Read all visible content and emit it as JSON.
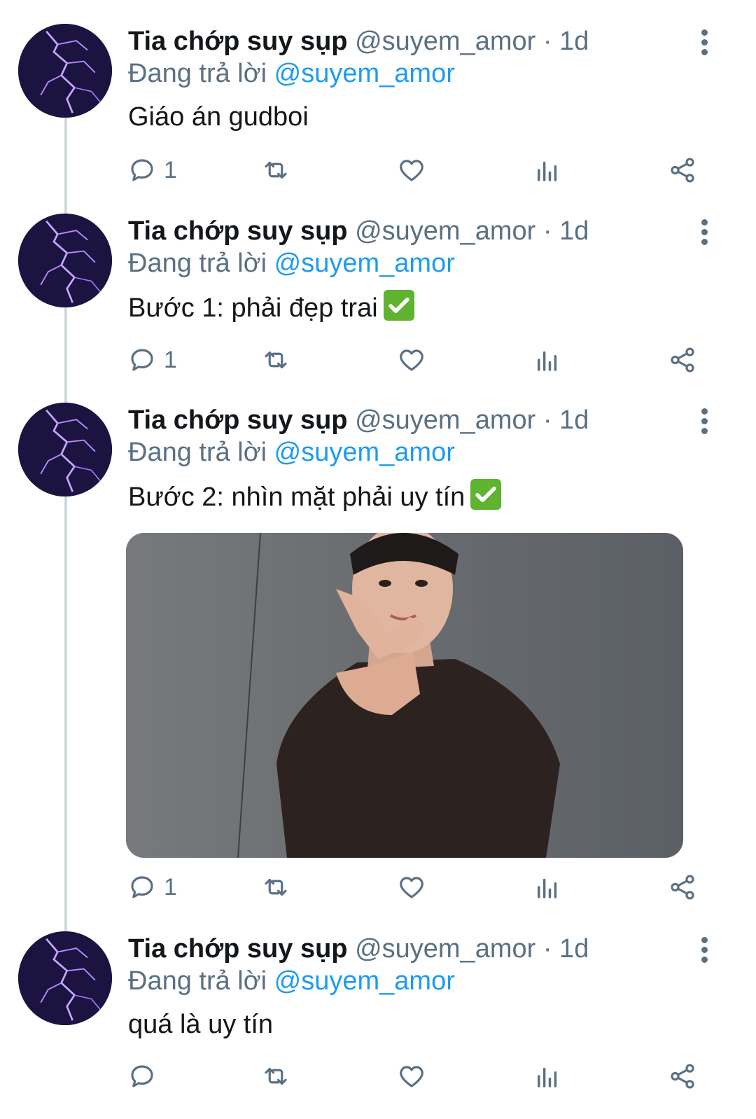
{
  "reply_prefix": "Đang trả lời",
  "tweets": [
    {
      "name": "Tia chớp suy sụp",
      "handle": "@suyem_amor",
      "separator": "·",
      "time": "1d",
      "reply_to": "@suyem_amor",
      "text": "Giáo án gudboi",
      "reply_count": "1",
      "has_check": false,
      "has_photo": false
    },
    {
      "name": "Tia chớp suy sụp",
      "handle": "@suyem_amor",
      "separator": "·",
      "time": "1d",
      "reply_to": "@suyem_amor",
      "text": "Bước 1: phải đẹp trai",
      "reply_count": "1",
      "has_check": true,
      "has_photo": false
    },
    {
      "name": "Tia chớp suy sụp",
      "handle": "@suyem_amor",
      "separator": "·",
      "time": "1d",
      "reply_to": "@suyem_amor",
      "text": "Bước 2: nhìn mặt phải uy tín",
      "reply_count": "1",
      "has_check": true,
      "has_photo": true
    },
    {
      "name": "Tia chớp suy sụp",
      "handle": "@suyem_amor",
      "separator": "·",
      "time": "1d",
      "reply_to": "@suyem_amor",
      "text": "quá là uy tín",
      "reply_count": "",
      "has_check": false,
      "has_photo": false
    }
  ],
  "icons": {
    "reply": "reply-icon",
    "retweet": "retweet-icon",
    "like": "heart-icon",
    "analytics": "analytics-icon",
    "share": "share-icon",
    "more": "more-vertical-icon",
    "check": "check-mark-icon"
  },
  "colors": {
    "mention": "#1d9bf0",
    "secondary_text": "#5b7083",
    "thread_line": "#cfd9de",
    "check_green": "#5fb32f",
    "avatar_bg": "#1b1340"
  }
}
